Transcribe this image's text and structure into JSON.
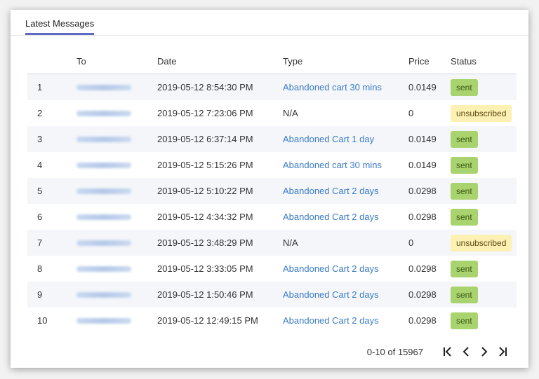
{
  "tabs": [
    {
      "label": "Latest Messages"
    }
  ],
  "table": {
    "headers": {
      "num": "",
      "to": "To",
      "date": "Date",
      "type": "Type",
      "price": "Price",
      "status": "Status"
    },
    "rows": [
      {
        "num": "1",
        "date": "2019-05-12 8:54:30 PM",
        "type": "Abandoned cart 30 mins",
        "price": "0.0149",
        "status": "sent"
      },
      {
        "num": "2",
        "date": "2019-05-12 7:23:06 PM",
        "type": "N/A",
        "price": "0",
        "status": "unsubscribed"
      },
      {
        "num": "3",
        "date": "2019-05-12 6:37:14 PM",
        "type": "Abandoned Cart 1 day",
        "price": "0.0149",
        "status": "sent"
      },
      {
        "num": "4",
        "date": "2019-05-12 5:15:26 PM",
        "type": "Abandoned cart 30 mins",
        "price": "0.0149",
        "status": "sent"
      },
      {
        "num": "5",
        "date": "2019-05-12 5:10:22 PM",
        "type": "Abandoned Cart 2 days",
        "price": "0.0298",
        "status": "sent"
      },
      {
        "num": "6",
        "date": "2019-05-12 4:34:32 PM",
        "type": "Abandoned Cart 2 days",
        "price": "0.0298",
        "status": "sent"
      },
      {
        "num": "7",
        "date": "2019-05-12 3:48:29 PM",
        "type": "N/A",
        "price": "0",
        "status": "unsubscribed"
      },
      {
        "num": "8",
        "date": "2019-05-12 3:33:05 PM",
        "type": "Abandoned Cart 2 days",
        "price": "0.0298",
        "status": "sent"
      },
      {
        "num": "9",
        "date": "2019-05-12 1:50:46 PM",
        "type": "Abandoned Cart 2 days",
        "price": "0.0298",
        "status": "sent"
      },
      {
        "num": "10",
        "date": "2019-05-12 12:49:15 PM",
        "type": "Abandoned Cart 2 days",
        "price": "0.0298",
        "status": "sent"
      }
    ]
  },
  "pagination": {
    "range": "0-10 of 15967",
    "icons": [
      "first-page-icon",
      "prev-page-icon",
      "next-page-icon",
      "last-page-icon"
    ]
  },
  "colors": {
    "tab_underline": "#5f6ac4",
    "link": "#3b7cc4",
    "sent_badge": "#a8d36f",
    "unsubscribed_badge": "#fdf0b3",
    "stripe": "#f4f6fa"
  }
}
